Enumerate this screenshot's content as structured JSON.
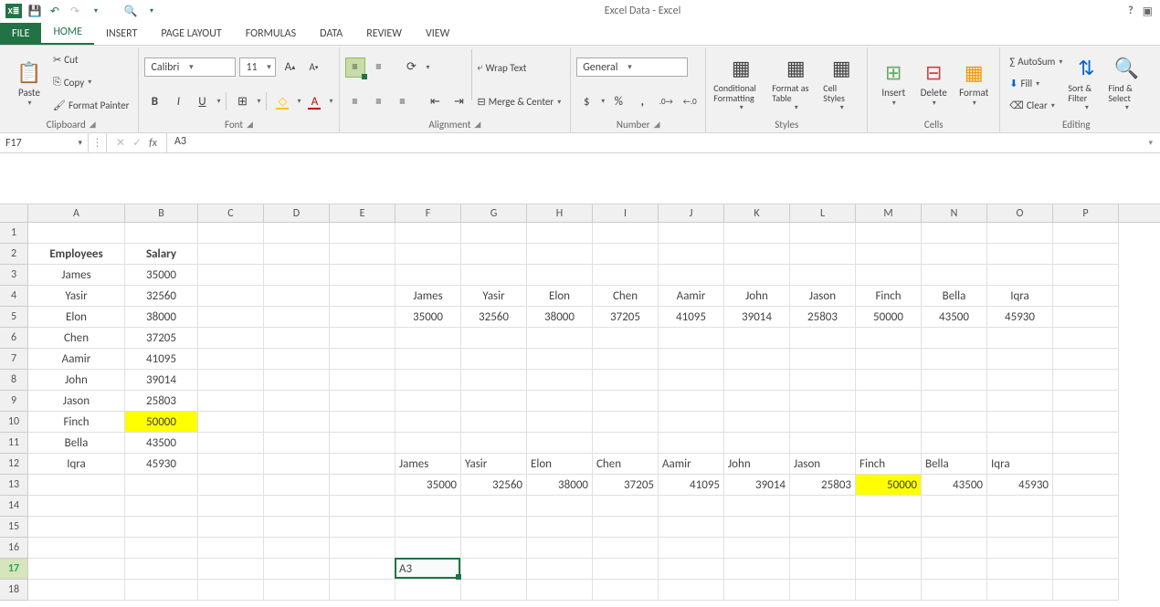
{
  "app": {
    "title": "Excel Data - Excel"
  },
  "tabs": {
    "file": "FILE",
    "home": "HOME",
    "insert": "INSERT",
    "pagelayout": "PAGE LAYOUT",
    "formulas": "FORMULAS",
    "data": "DATA",
    "review": "REVIEW",
    "view": "VIEW"
  },
  "ribbon": {
    "clipboard": {
      "paste": "Paste",
      "cut": "Cut",
      "copy": "Copy",
      "fp": "Format Painter",
      "label": "Clipboard"
    },
    "font": {
      "name": "Calibri",
      "size": "11",
      "bold": "B",
      "italic": "I",
      "underline": "U",
      "label": "Font"
    },
    "alignment": {
      "wrap": "Wrap Text",
      "merge": "Merge & Center",
      "label": "Alignment"
    },
    "number": {
      "format": "General",
      "label": "Number"
    },
    "styles": {
      "cond": "Conditional Formatting",
      "table": "Format as Table",
      "cell": "Cell Styles",
      "label": "Styles"
    },
    "cells": {
      "insert": "Insert",
      "delete": "Delete",
      "format": "Format",
      "label": "Cells"
    },
    "editing": {
      "sum": "AutoSum",
      "fill": "Fill",
      "clear": "Clear",
      "sort": "Sort & Filter",
      "find": "Find & Select",
      "label": "Editing"
    }
  },
  "formula": {
    "cellref": "F17",
    "fx": "A3"
  },
  "cols": [
    "A",
    "B",
    "C",
    "D",
    "E",
    "F",
    "G",
    "H",
    "I",
    "J",
    "K",
    "L",
    "M",
    "N",
    "O",
    "P"
  ],
  "rows": [
    "1",
    "2",
    "3",
    "4",
    "5",
    "6",
    "7",
    "8",
    "9",
    "10",
    "11",
    "12",
    "13",
    "14",
    "15",
    "16",
    "17",
    "18"
  ],
  "headers": {
    "emp": "Employees",
    "sal": "Salary"
  },
  "data": {
    "names": [
      "James",
      "Yasir",
      "Elon",
      "Chen",
      "Aamir",
      "John",
      "Jason",
      "Finch",
      "Bella",
      "Iqra"
    ],
    "salaries": [
      "35000",
      "32560",
      "38000",
      "37205",
      "41095",
      "39014",
      "25803",
      "50000",
      "43500",
      "45930"
    ]
  },
  "editing_cell": "A3"
}
